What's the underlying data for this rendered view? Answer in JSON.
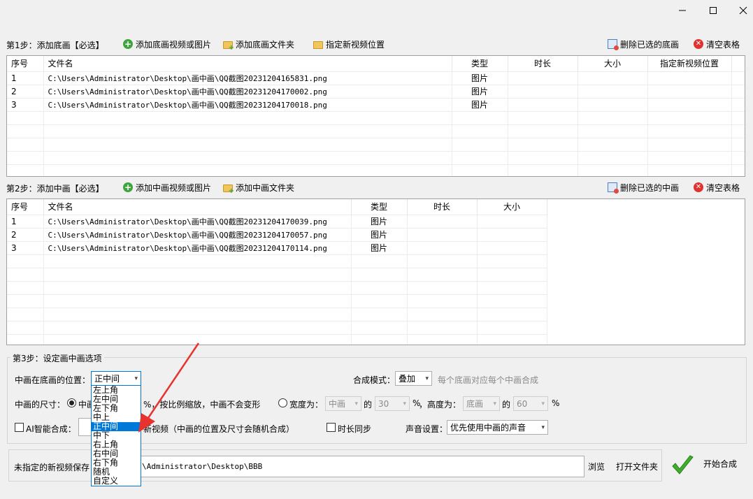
{
  "window": {
    "controls": [
      "minimize-icon",
      "maximize-icon",
      "close-icon"
    ]
  },
  "step1": {
    "title": "第1步：添加底画【必选】",
    "add_media": "添加底画视频或图片",
    "add_folder": "添加底画文件夹",
    "set_position": "指定新视频位置",
    "delete_selected": "删除已选的底画",
    "clear": "清空表格",
    "columns": [
      "序号",
      "文件名",
      "类型",
      "时长",
      "大小",
      "指定新视频位置"
    ],
    "rows": [
      {
        "no": "1",
        "file": "C:\\Users\\Administrator\\Desktop\\画中画\\QQ截图20231204165831.png",
        "type": "图片",
        "duration": "",
        "size": "",
        "position": ""
      },
      {
        "no": "2",
        "file": "C:\\Users\\Administrator\\Desktop\\画中画\\QQ截图20231204170002.png",
        "type": "图片",
        "duration": "",
        "size": "",
        "position": ""
      },
      {
        "no": "3",
        "file": "C:\\Users\\Administrator\\Desktop\\画中画\\QQ截图20231204170018.png",
        "type": "图片",
        "duration": "",
        "size": "",
        "position": ""
      }
    ]
  },
  "step2": {
    "title": "第2步：添加中画【必选】",
    "add_media": "添加中画视频或图片",
    "add_folder": "添加中画文件夹",
    "delete_selected": "删除已选的中画",
    "clear": "清空表格",
    "columns": [
      "序号",
      "文件名",
      "类型",
      "时长",
      "大小"
    ],
    "rows": [
      {
        "no": "1",
        "file": "C:\\Users\\Administrator\\Desktop\\画中画\\QQ截图20231204170039.png",
        "type": "图片",
        "duration": "",
        "size": ""
      },
      {
        "no": "2",
        "file": "C:\\Users\\Administrator\\Desktop\\画中画\\QQ截图20231204170057.png",
        "type": "图片",
        "duration": "",
        "size": ""
      },
      {
        "no": "3",
        "file": "C:\\Users\\Administrator\\Desktop\\画中画\\QQ截图20231204170114.png",
        "type": "图片",
        "duration": "",
        "size": ""
      }
    ]
  },
  "step3": {
    "title": "第3步：设定画中画选项",
    "position_label": "中画在底画的位置：",
    "position_value": "正中间",
    "position_options": [
      "左上角",
      "左中间",
      "左下角",
      "中上",
      "正中间",
      "中下",
      "右上角",
      "右中间",
      "右下角",
      "随机",
      "自定义"
    ],
    "position_selected_index": 4,
    "compose_mode_label": "合成模式：",
    "compose_mode_value": "叠加",
    "compose_mode_hint": "每个底画对应每个中画合成",
    "size_label": "中画的尺寸：",
    "size_radio1_text": "中画",
    "size_radio1_suffix": "%，按比例缩放，中画不会变形",
    "width_radio_label": "宽度为：",
    "width_ref": "中画",
    "of1": "的",
    "width_percent": "30",
    "pct1": "%",
    "height_label": "，高度为：",
    "height_ref": "底画",
    "of2": "的",
    "height_percent": "60",
    "pct2": "%",
    "ai_label": "AI智能合成：",
    "ai_suffix": "新视频（中画的位置及尺寸会随机合成）",
    "duration_sync": "时长同步",
    "audio_label": "声音设置：",
    "audio_value": "优先使用中画的声音"
  },
  "output": {
    "label": "未指定的新视频保存",
    "path": "\\Administrator\\Desktop\\BBB",
    "browse": "浏览",
    "open_folder": "打开文件夹",
    "start": "开始合成"
  },
  "colors": {
    "accent": "#0078d7",
    "annotation_arrow": "#e8322e",
    "start_check": "#3fae2a"
  }
}
